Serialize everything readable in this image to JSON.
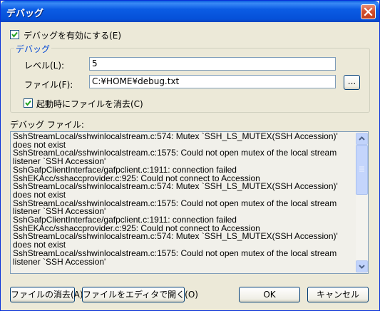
{
  "window": {
    "title": "デバッグ"
  },
  "enable_debug": {
    "label": "デバッグを有効にする(E)",
    "checked": true
  },
  "group": {
    "title": "デバッグ",
    "level_label": "レベル(L):",
    "level_value": "5",
    "file_label": "ファイル(F):",
    "file_value": "C:¥HOME¥debug.txt",
    "browse_label": "...",
    "clear_on_start_label": "起動時にファイルを消去(C)",
    "clear_on_start_checked": true
  },
  "debug_file": {
    "label": "デバッグ ファイル:",
    "lines": [
      "SshStreamLocal/sshwinlocalstream.c:574: Mutex `SSH_LS_MUTEX(SSH Accession)' does not exist",
      "SshStreamLocal/sshwinlocalstream.c:1575: Could not open mutex of the local stream listener `SSH Accession'",
      "SshGafpClientInterface/gafpclient.c:1911: connection failed",
      "SshEKAcc/sshaccprovider.c:925: Could not connect to Accession",
      "SshStreamLocal/sshwinlocalstream.c:574: Mutex `SSH_LS_MUTEX(SSH Accession)' does not exist",
      "SshStreamLocal/sshwinlocalstream.c:1575: Could not open mutex of the local stream listener `SSH Accession'",
      "SshGafpClientInterface/gafpclient.c:1911: connection failed",
      "SshEKAcc/sshaccprovider.c:925: Could not connect to Accession",
      "SshStreamLocal/sshwinlocalstream.c:574: Mutex `SSH_LS_MUTEX(SSH Accession)' does not exist",
      "SshStreamLocal/sshwinlocalstream.c:1575: Could not open mutex of the local stream listener `SSH Accession'"
    ]
  },
  "buttons": {
    "clear_file": "ファイルの消去(A)",
    "open_in_editor": "ファイルをエディタで開く(O)",
    "ok": "OK",
    "cancel": "キャンセル"
  },
  "colors": {
    "titlebar": "#0a5fdf",
    "accent": "#0046d5",
    "close": "#d24c2a"
  }
}
